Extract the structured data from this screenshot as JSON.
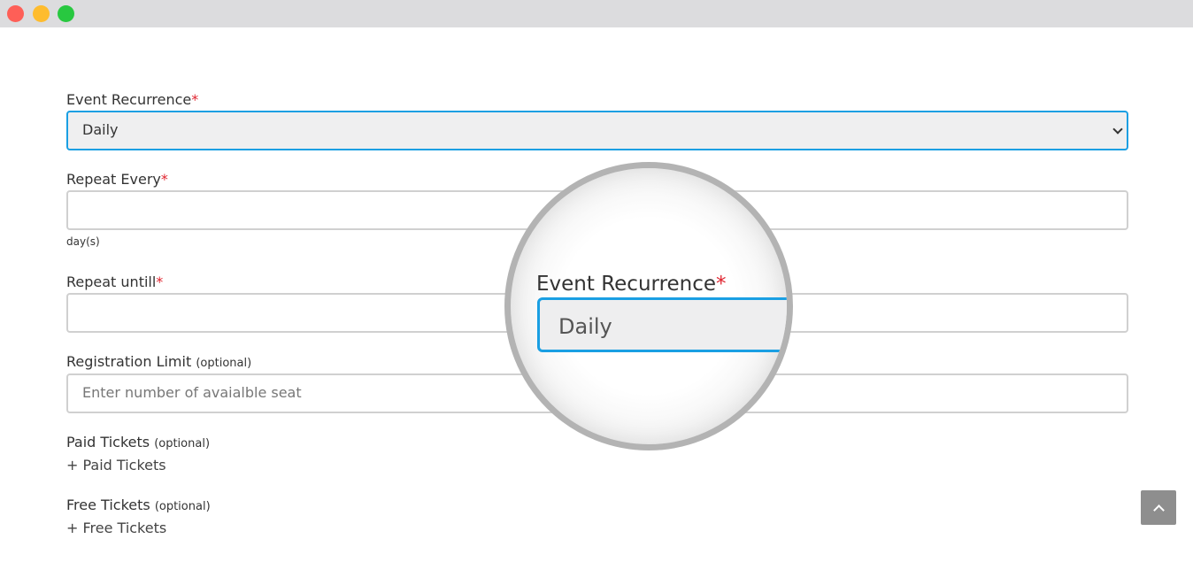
{
  "form": {
    "event_recurrence": {
      "label": "Event Recurrence",
      "required_mark": "*",
      "value": "Daily"
    },
    "repeat_every": {
      "label": "Repeat Every",
      "required_mark": "*",
      "value": "",
      "helper": "day(s)"
    },
    "repeat_until": {
      "label": "Repeat untill",
      "required_mark": "*",
      "value": ""
    },
    "registration_limit": {
      "label": "Registration Limit",
      "optional": "(optional)",
      "placeholder": "Enter number of avaialble seat"
    },
    "paid_tickets": {
      "label": "Paid Tickets",
      "optional": "(optional)",
      "link": "+ Paid Tickets"
    },
    "free_tickets": {
      "label": "Free Tickets",
      "optional": "(optional)",
      "link": "+ Free Tickets"
    }
  },
  "magnifier": {
    "label": "Event Recurrence",
    "required_mark": "*",
    "value": "Daily"
  },
  "icons": {
    "scroll_top": "chevron-up-icon",
    "select_arrow": "chevron-down-icon"
  },
  "colors": {
    "accent": "#1a9fe3",
    "required": "#e0242f",
    "scroll_button": "#8e8e8e"
  }
}
